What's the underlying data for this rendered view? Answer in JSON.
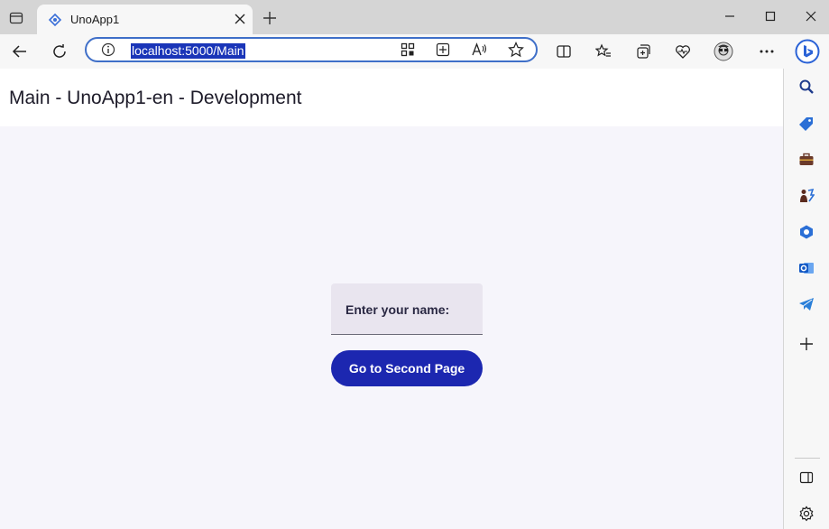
{
  "browser": {
    "tab": {
      "title": "UnoApp1"
    },
    "address_bar": {
      "url": "localhost:5000/Main"
    }
  },
  "page": {
    "header_title": "Main - UnoApp1-en - Development",
    "name_field": {
      "label": "Enter your name:",
      "value": ""
    },
    "go_button": {
      "label": "Go to Second Page"
    }
  },
  "colors": {
    "accent_button": "#1c27b0",
    "page_background": "#f6f5fb",
    "address_selection": "#1a35b8"
  },
  "icons": {
    "titlebar": [
      "tab-actions-icon",
      "app-favicon-icon",
      "close-tab-icon",
      "new-tab-icon",
      "minimize-icon",
      "maximize-icon",
      "close-window-icon"
    ],
    "toolbar": [
      "back-icon",
      "refresh-icon",
      "site-info-icon",
      "apps-icon",
      "add-extension-icon",
      "read-aloud-icon",
      "favorite-star-icon",
      "split-screen-icon",
      "favorites-icon",
      "collections-icon",
      "browser-essentials-icon",
      "profile-avatar-icon",
      "more-icon",
      "bing-icon"
    ],
    "sidebar": [
      "search-icon",
      "shopping-icon",
      "tools-icon",
      "games-icon",
      "office-icon",
      "outlook-icon",
      "telegram-icon",
      "add-icon",
      "hide-sidebar-icon",
      "settings-icon"
    ]
  }
}
